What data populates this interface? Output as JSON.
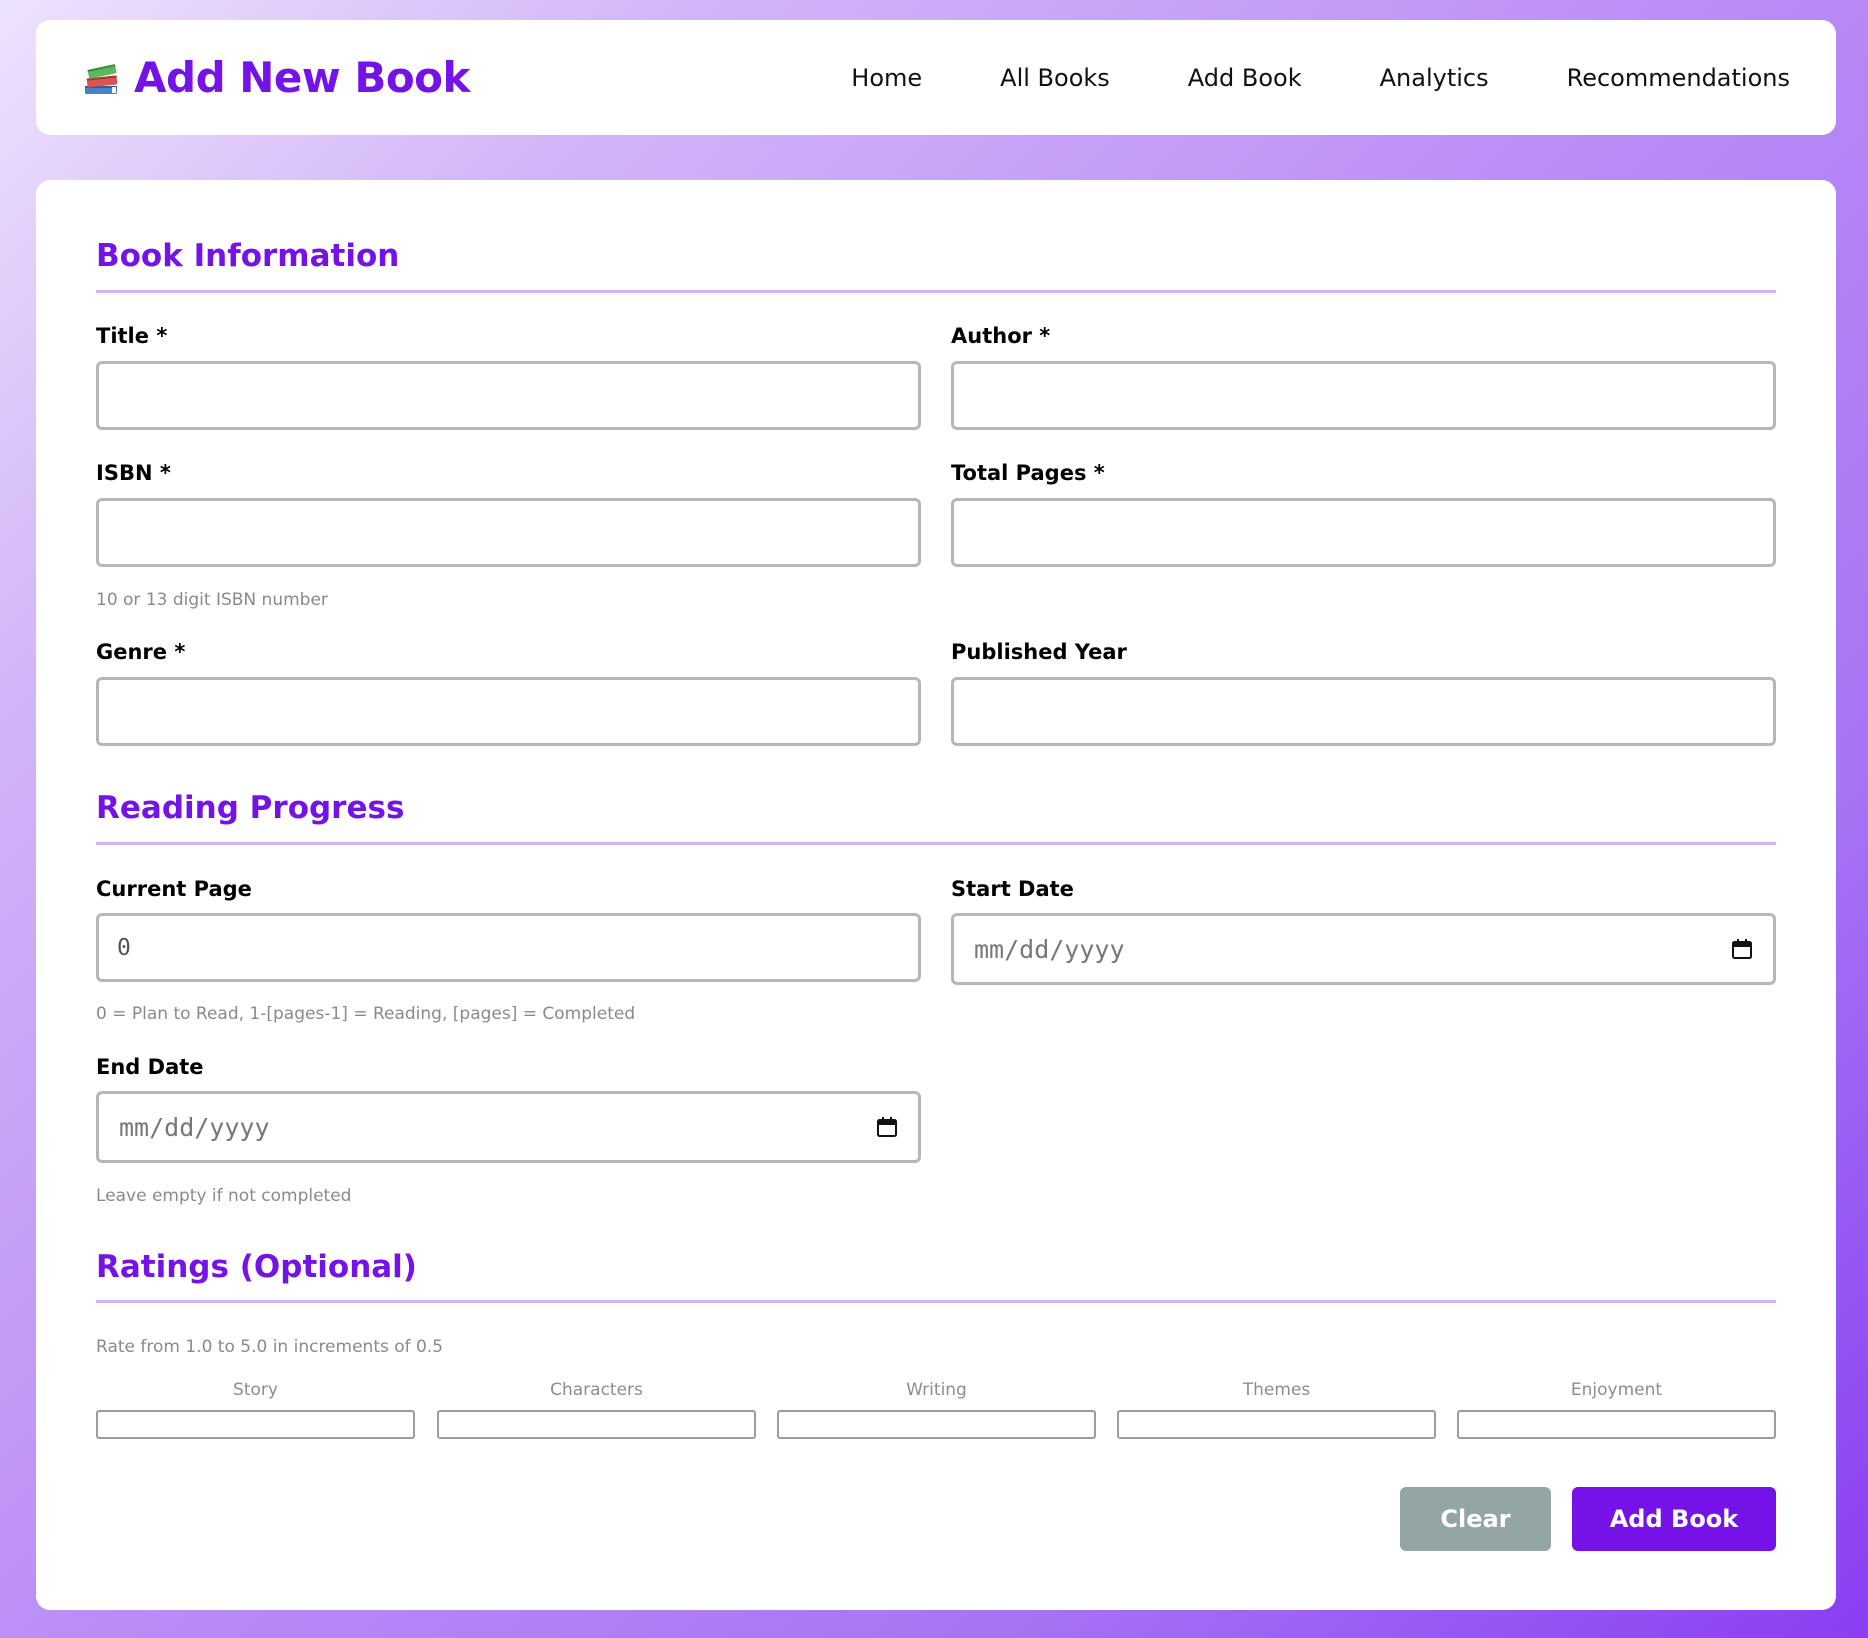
{
  "header": {
    "title": "Add New Book",
    "nav": [
      "Home",
      "All Books",
      "Add Book",
      "Analytics",
      "Recommendations"
    ]
  },
  "sections": {
    "book_info": "Book Information",
    "reading_progress": "Reading Progress",
    "ratings": "Ratings (Optional)"
  },
  "fields": {
    "title": {
      "label": "Title *",
      "value": ""
    },
    "author": {
      "label": "Author *",
      "value": ""
    },
    "isbn": {
      "label": "ISBN *",
      "value": "",
      "hint": "10 or 13 digit ISBN number"
    },
    "total_pages": {
      "label": "Total Pages *",
      "value": ""
    },
    "genre": {
      "label": "Genre *",
      "value": ""
    },
    "published_year": {
      "label": "Published Year",
      "value": ""
    },
    "current_page": {
      "label": "Current Page",
      "value": "0",
      "hint": "0 = Plan to Read, 1-[pages-1] = Reading, [pages] = Completed"
    },
    "start_date": {
      "label": "Start Date",
      "placeholder": "mm/dd/yyyy"
    },
    "end_date": {
      "label": "End Date",
      "placeholder": "mm/dd/yyyy",
      "hint": "Leave empty if not completed"
    }
  },
  "ratings": {
    "hint": "Rate from 1.0 to 5.0 in increments of 0.5",
    "categories": [
      "Story",
      "Characters",
      "Writing",
      "Themes",
      "Enjoyment"
    ]
  },
  "buttons": {
    "clear": "Clear",
    "add": "Add Book"
  },
  "colors": {
    "accent": "#7412e8",
    "rule": "#d5b3f9",
    "clear_button": "#94a5a6"
  },
  "icons": {
    "brand": "books-icon",
    "date": "calendar-icon"
  }
}
